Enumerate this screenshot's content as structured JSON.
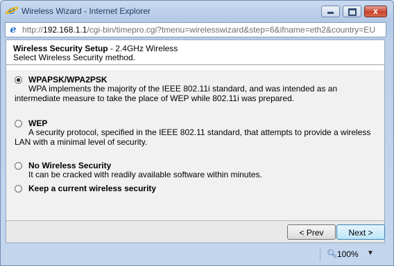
{
  "window": {
    "title": "Wireless Wizard - Internet Explorer",
    "minimize_glyph": "",
    "close_glyph": "x",
    "icon": "internet-explorer-icon"
  },
  "address": {
    "prefix": "http://",
    "host": "192.168.1.1",
    "path": "/cgi-bin/timepro.cgi?tmenu=wirelesswizard&step=6&ifname=eth2&country=EU"
  },
  "page": {
    "title": "Wireless Security Setup",
    "subtitle": " - 2.4GHz Wireless",
    "instruction": "Select Wireless Security method."
  },
  "options": [
    {
      "label": "WPAPSK/WPA2PSK",
      "description": "WPA implements the majority of the IEEE 802.11i standard, and was intended as an intermediate measure to take the place of WEP while 802.11i was prepared.",
      "checked": true
    },
    {
      "label": "WEP",
      "description": "A security protocol, specified in the IEEE 802.11 standard, that attempts to provide a wireless LAN with a minimal level of security.",
      "checked": false
    },
    {
      "label": "No Wireless Security",
      "description": "It can be cracked with readily available software within minutes.",
      "checked": false
    },
    {
      "label": "Keep a current wireless security",
      "description": "",
      "checked": false
    }
  ],
  "buttons": {
    "prev": "< Prev",
    "next": "Next >"
  },
  "status": {
    "zoom": "100%",
    "zoom_arrow": "▼"
  },
  "colors": {
    "next_button_bg": "#bde6f8",
    "options_bg": "#f1f1f1"
  }
}
